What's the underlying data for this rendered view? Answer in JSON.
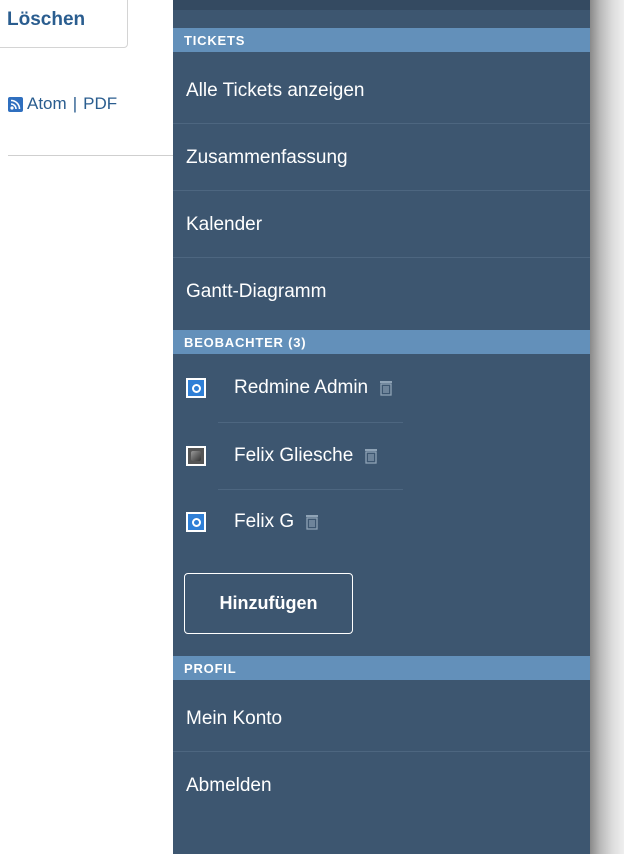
{
  "page": {
    "delete_label": "Löschen",
    "export": {
      "atom_label": "Atom",
      "separator": "|",
      "pdf_label": "PDF"
    }
  },
  "sidebar": {
    "tickets_header": "TICKETS",
    "ticket_links": [
      {
        "label": "Alle Tickets anzeigen"
      },
      {
        "label": "Zusammenfassung"
      },
      {
        "label": "Kalender"
      },
      {
        "label": "Gantt-Diagramm"
      }
    ],
    "watchers_header": "BEOBACHTER (3)",
    "watchers": [
      {
        "name": "Redmine Admin",
        "avatar": "power-avatar-icon"
      },
      {
        "name": "Felix Gliesche",
        "avatar": "photo-avatar-icon"
      },
      {
        "name": "Felix G",
        "avatar": "power-avatar-icon"
      }
    ],
    "add_watcher_label": "Hinzufügen",
    "profile_header": "PROFIL",
    "profile_links": [
      {
        "label": "Mein Konto"
      },
      {
        "label": "Abmelden"
      }
    ]
  },
  "colors": {
    "sidebar_bg": "#3d5670",
    "section_header_bg": "#6390ba",
    "link_blue": "#2a5d8f"
  }
}
